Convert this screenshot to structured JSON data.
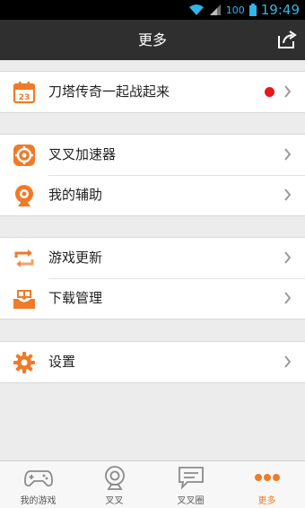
{
  "status_bar": {
    "battery": "100",
    "time": "19:49",
    "icons": [
      "wifi-icon",
      "signal-icon",
      "battery-icon"
    ]
  },
  "header": {
    "title": "更多",
    "share_icon": "share-icon"
  },
  "groups": [
    {
      "items": [
        {
          "label": "刀塔传奇一起战起来",
          "icon": "calendar-icon",
          "badge": "red-dot"
        }
      ]
    },
    {
      "items": [
        {
          "label": "叉叉加速器",
          "icon": "accelerator-gear-icon"
        },
        {
          "label": "我的辅助",
          "icon": "assistant-webcam-icon"
        }
      ]
    },
    {
      "items": [
        {
          "label": "游戏更新",
          "icon": "update-arrows-icon"
        },
        {
          "label": "下载管理",
          "icon": "download-tray-icon"
        }
      ]
    },
    {
      "items": [
        {
          "label": "设置",
          "icon": "settings-gear-icon"
        }
      ]
    }
  ],
  "tabs": [
    {
      "label": "我的游戏",
      "icon": "gamepad-icon",
      "active": false
    },
    {
      "label": "叉叉",
      "icon": "webcam-icon",
      "active": false
    },
    {
      "label": "叉叉圈",
      "icon": "chat-bubble-icon",
      "active": false
    },
    {
      "label": "更多",
      "icon": "more-dots-icon",
      "active": true
    }
  ],
  "colors": {
    "accent": "#f07a28",
    "header_bg": "#2f2f2f",
    "status_text": "#33b5e5",
    "page_bg": "#ececec",
    "badge": "#e8181b"
  }
}
